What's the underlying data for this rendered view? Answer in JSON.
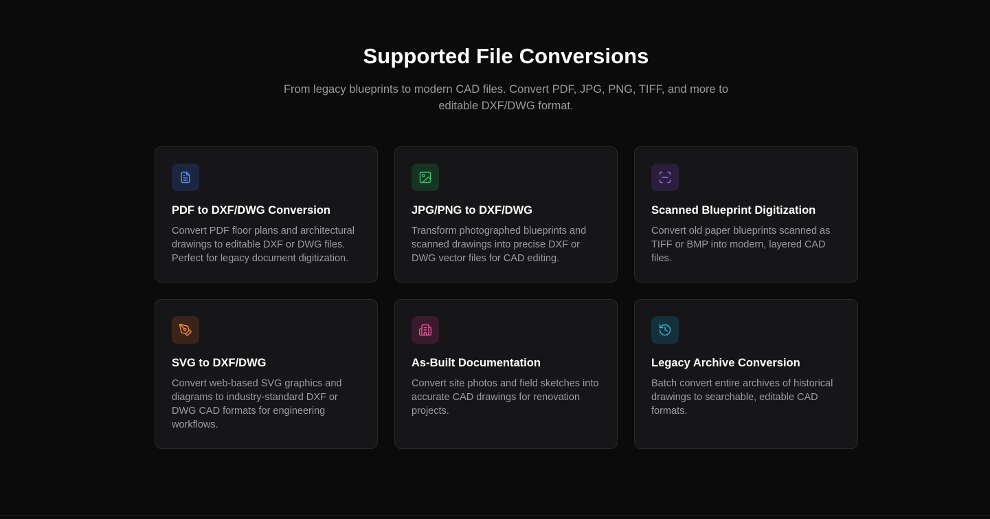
{
  "section": {
    "title": "Supported File Conversions",
    "subtitle": "From legacy blueprints to modern CAD files. Convert PDF, JPG, PNG, TIFF, and more to editable DXF/DWG format."
  },
  "cards": [
    {
      "icon": "document-icon",
      "accent": "#5b8def",
      "icon_bg": "#1b2640",
      "title": "PDF to DXF/DWG Conversion",
      "description": "Convert PDF floor plans and architectural drawings to editable DXF or DWG files. Perfect for legacy document digitization."
    },
    {
      "icon": "image-icon",
      "accent": "#3fbf6f",
      "icon_bg": "#173324",
      "title": "JPG/PNG to DXF/DWG",
      "description": "Transform photographed blueprints and scanned drawings into precise DXF or DWG vector files for CAD editing."
    },
    {
      "icon": "scan-icon",
      "accent": "#a66bf0",
      "icon_bg": "#2a1e3c",
      "title": "Scanned Blueprint Digitization",
      "description": "Convert old paper blueprints scanned as TIFF or BMP into modern, layered CAD files."
    },
    {
      "icon": "pen-tool-icon",
      "accent": "#f08a3c",
      "icon_bg": "#3a2419",
      "title": "SVG to DXF/DWG",
      "description": "Convert web-based SVG graphics and diagrams to industry-standard DXF or DWG CAD formats for engineering workflows."
    },
    {
      "icon": "building-icon",
      "accent": "#e05a9a",
      "icon_bg": "#3a1a2c",
      "title": "As-Built Documentation",
      "description": "Convert site photos and field sketches into accurate CAD drawings for renovation projects."
    },
    {
      "icon": "history-icon",
      "accent": "#2fb8d6",
      "icon_bg": "#14303a",
      "title": "Legacy Archive Conversion",
      "description": "Batch convert entire archives of historical drawings to searchable, editable CAD formats."
    }
  ]
}
